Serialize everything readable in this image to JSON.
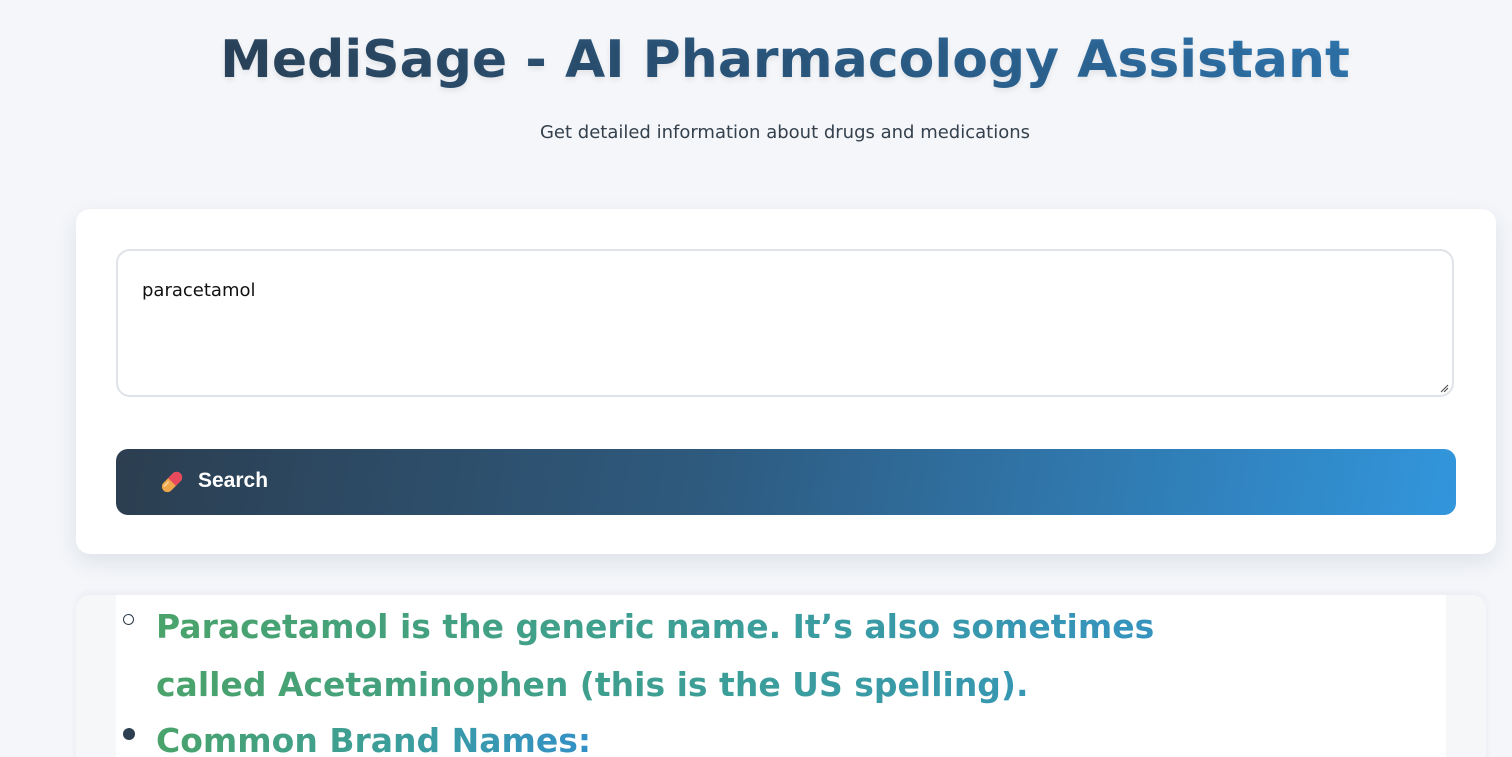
{
  "header": {
    "title": "MediSage - AI Pharmacology Assistant",
    "subtitle": "Get detailed information about drugs and medications"
  },
  "search": {
    "query_value": "paracetamol",
    "button_label": "Search",
    "button_icon": "pill-icon"
  },
  "results": {
    "items": [
      {
        "text": "Paracetamol is the generic name. It’s also sometimes called Acetaminophen (this is the US spelling).",
        "bullet": "circle"
      },
      {
        "text": "Common Brand Names:",
        "bullet": "disc"
      }
    ]
  },
  "colors": {
    "title_gradient_start": "#2c3e50",
    "title_gradient_end": "#3182c2",
    "button_gradient_start": "#2c3e50",
    "button_gradient_end": "#3296dc",
    "result_text_green": "#4aa36a",
    "result_text_teal": "#3390c8",
    "background": "#f4f6fa"
  }
}
